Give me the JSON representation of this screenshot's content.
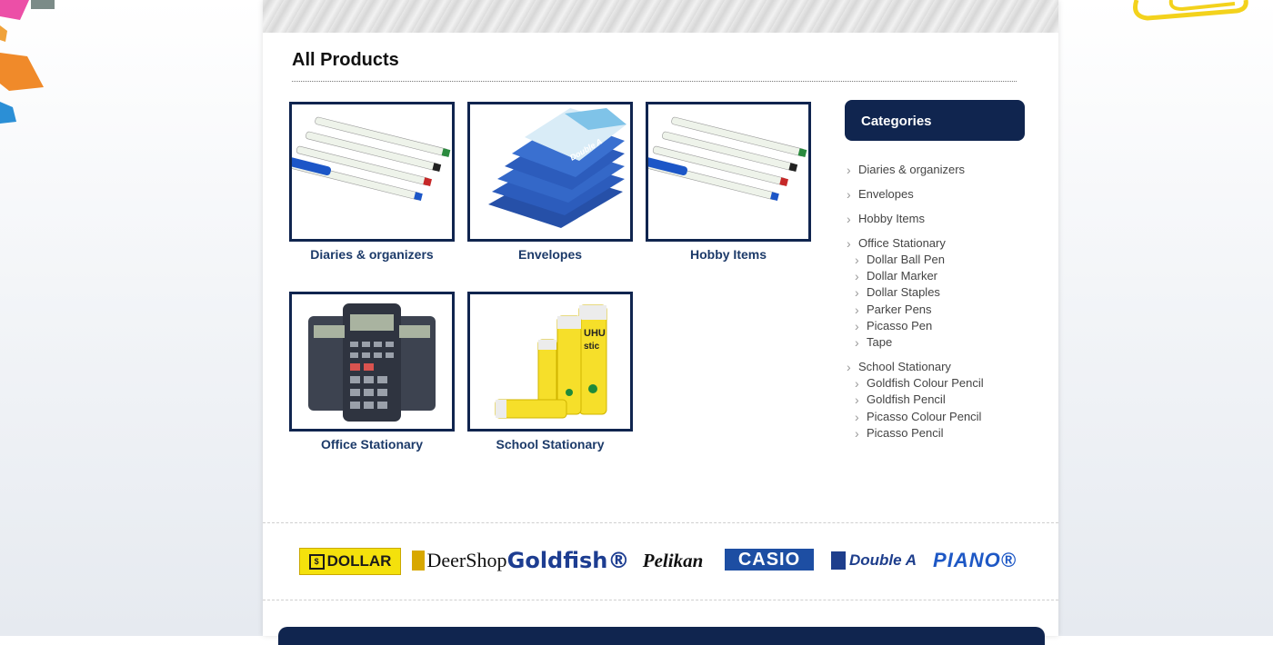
{
  "content": {
    "title": "All Products",
    "products": [
      {
        "name": "Diaries & organizers",
        "image": "pens"
      },
      {
        "name": "Envelopes",
        "image": "paper-reams"
      },
      {
        "name": "Hobby Items",
        "image": "pens"
      },
      {
        "name": "Office Stationary",
        "image": "calculators"
      },
      {
        "name": "School Stationary",
        "image": "glue-sticks"
      }
    ]
  },
  "sidebar": {
    "heading": "Categories",
    "items": [
      {
        "label": "Diaries & organizers",
        "children": []
      },
      {
        "label": "Envelopes",
        "children": []
      },
      {
        "label": "Hobby Items",
        "children": []
      },
      {
        "label": "Office Stationary",
        "children": [
          "Dollar Ball Pen",
          "Dollar Marker",
          "Dollar Staples",
          "Parker Pens",
          "Picasso Pen",
          "Tape"
        ]
      },
      {
        "label": "School Stationary",
        "children": [
          "Goldfish Colour Pencil",
          "Goldfish Pencil",
          "Picasso Colour Pencil",
          "Picasso Pencil"
        ]
      }
    ]
  },
  "brands": [
    {
      "name": "DOLLAR",
      "logo": "dollar-logo"
    },
    {
      "name": "DeerShop",
      "logo": "deershop-logo"
    },
    {
      "name": "Goldfish®",
      "logo": "goldfish-logo"
    },
    {
      "name": "Pelikan",
      "logo": "pelikan-logo"
    },
    {
      "name": "CASIO",
      "logo": "casio-logo"
    },
    {
      "name": "Double A",
      "logo": "double-a-logo"
    },
    {
      "name": "PIANO®",
      "logo": "piano-logo"
    }
  ],
  "colors": {
    "navy": "#10254f",
    "caption": "#1c3a69"
  }
}
